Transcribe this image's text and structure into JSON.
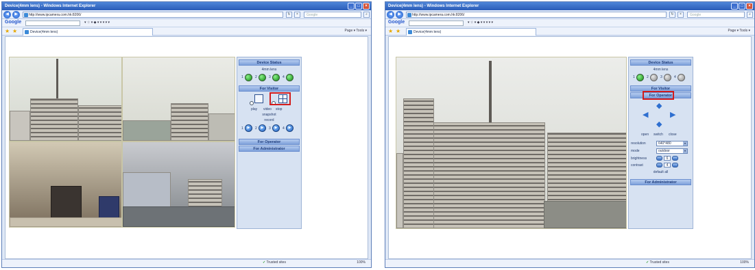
{
  "colors": {
    "titlebar": "#2a5cb8",
    "panel_header": "#7ea1da",
    "highlight": "#d21b1b",
    "status_on": "#118a11"
  },
  "left": {
    "window_title": "Device(4mm lens) - Windows Internet Explorer",
    "url": "http://www.ipcamera.com.hk:8206/",
    "search_placeholder": "Google",
    "google_label": "Google",
    "tab_title": "Device(4mm lens)",
    "commands": "Page ▾  Tools ▾",
    "status_zone": "Trusted sites",
    "status_zoom": "100%",
    "panel": {
      "device_status": "Device Status",
      "lens": "4mm lens",
      "channels": [
        "1",
        "2",
        "3",
        "4"
      ],
      "for_visitor": "For Visitor",
      "play": "play",
      "video": "video",
      "stop": "stop",
      "snapshot": "snapshot",
      "record": "record",
      "for_operator": "For Operator",
      "for_administrator": "For Administrator"
    }
  },
  "right": {
    "window_title": "Device(4mm lens) - Windows Internet Explorer",
    "url": "http://www.ipcamera.com.hk:8206/",
    "search_placeholder": "Google",
    "google_label": "Google",
    "tab_title": "Device(4mm lens)",
    "commands": "Page ▾  Tools ▾",
    "status_zone": "Trusted sites",
    "status_zoom": "100%",
    "panel": {
      "device_status": "Device Status",
      "lens": "4mm lens",
      "channels": [
        "1",
        "2",
        "3",
        "4"
      ],
      "for_visitor": "For Visitor",
      "for_operator": "For Operator",
      "open": "open",
      "switch": "switch",
      "close": "close",
      "resolution_label": "resolution",
      "resolution_value": "640*480",
      "mode_label": "mode",
      "mode_value": "outdoor",
      "brightness_label": "brightness",
      "brightness_value": "6",
      "contrast_label": "contrast",
      "contrast_value": "4",
      "default_all": "default all",
      "for_administrator": "For Administrator"
    }
  }
}
